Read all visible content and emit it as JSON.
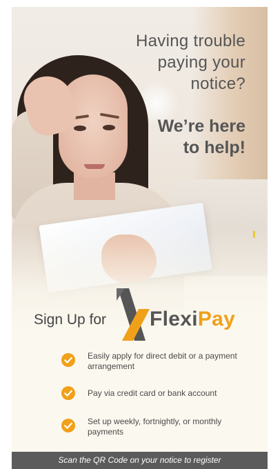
{
  "headline": {
    "lines": [
      "Having trouble",
      "paying your",
      "notice?"
    ]
  },
  "subheadline": {
    "lines": [
      "We’re here",
      "to help!"
    ]
  },
  "signup": {
    "prefix": "Sign Up for",
    "logo_part1": "Flexi",
    "logo_part2": "Pay"
  },
  "features": [
    {
      "text": "Easily apply for direct debit or a payment arrangement",
      "icon": "check-circle-icon"
    },
    {
      "text": "Pay via credit card or bank account",
      "icon": "check-circle-icon"
    },
    {
      "text": "Set up weekly, fortnightly, or monthly payments",
      "icon": "check-circle-icon"
    }
  ],
  "footer": {
    "text": "Scan the QR Code on your notice to register"
  },
  "colors": {
    "accent": "#f0a019",
    "text": "#555555",
    "footer_bg": "#5b5b5b",
    "background": "#fbf8ef"
  }
}
